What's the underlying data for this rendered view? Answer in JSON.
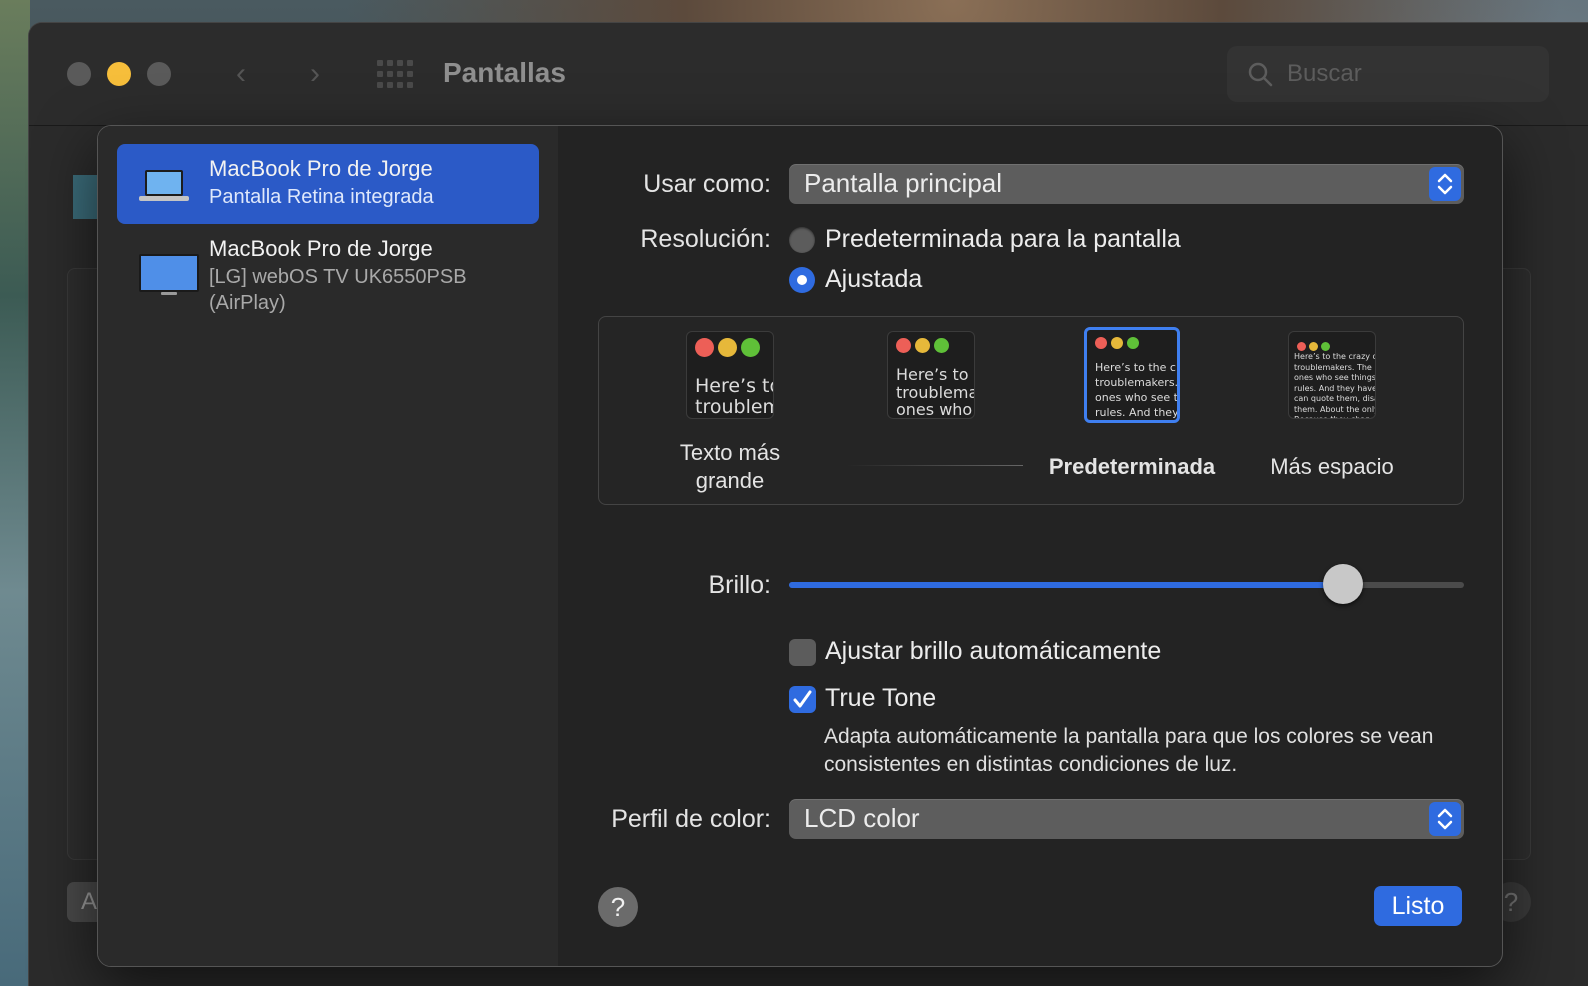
{
  "window": {
    "title": "Pantallas",
    "search_placeholder": "Buscar",
    "behind_help": "?",
    "behind_button_fragment": "A"
  },
  "sidebar": {
    "items": [
      {
        "name": "MacBook Pro de Jorge",
        "subtitle": "Pantalla Retina integrada",
        "selected": true,
        "icon": "laptop-icon"
      },
      {
        "name": "MacBook Pro de Jorge",
        "subtitle": "[LG] webOS TV UK6550PSB",
        "subtitle2": "(AirPlay)",
        "selected": false,
        "icon": "tv-display-icon"
      }
    ]
  },
  "settings": {
    "usar_como": {
      "label": "Usar como:",
      "value": "Pantalla principal"
    },
    "resolucion": {
      "label": "Resolución:",
      "options": [
        {
          "label": "Predeterminada para la pantalla",
          "selected": false
        },
        {
          "label": "Ajustada",
          "selected": true
        }
      ],
      "scales": [
        {
          "label": "Texto más\ngrande",
          "preview": "Here’s to t\ntroublem",
          "selected": false
        },
        {
          "label": "",
          "preview": "Here’s to t\ntroublema\nones who",
          "selected": false
        },
        {
          "label": "Predeterminada",
          "preview": "Here’s to the cr\ntroublemakers.\nones who see t\nrules. And they",
          "selected": true
        },
        {
          "label": "Más espacio",
          "preview": "Here’s to the crazy one\ntroublemakers. The rou\nones who see things dif\nrules. And they have no\ncan quote them, disagr\nthem. About the only th\nBecause they change t",
          "selected": false
        }
      ]
    },
    "brillo": {
      "label": "Brillo:",
      "value_fraction": 0.82
    },
    "auto_brillo": {
      "label": "Ajustar brillo automáticamente",
      "checked": false
    },
    "true_tone": {
      "label": "True Tone",
      "checked": true,
      "description": "Adapta automáticamente la pantalla para que los colores se vean consistentes en distintas condiciones de luz."
    },
    "perfil_color": {
      "label": "Perfil de color:",
      "value": "LCD color"
    }
  },
  "footer": {
    "help": "?",
    "done": "Listo"
  },
  "colors": {
    "accent": "#2f6be0",
    "selection": "#2b5ac7",
    "close_red": "#ed5f57",
    "min_yellow": "#f6be3b",
    "max_green": "#5fc038"
  }
}
